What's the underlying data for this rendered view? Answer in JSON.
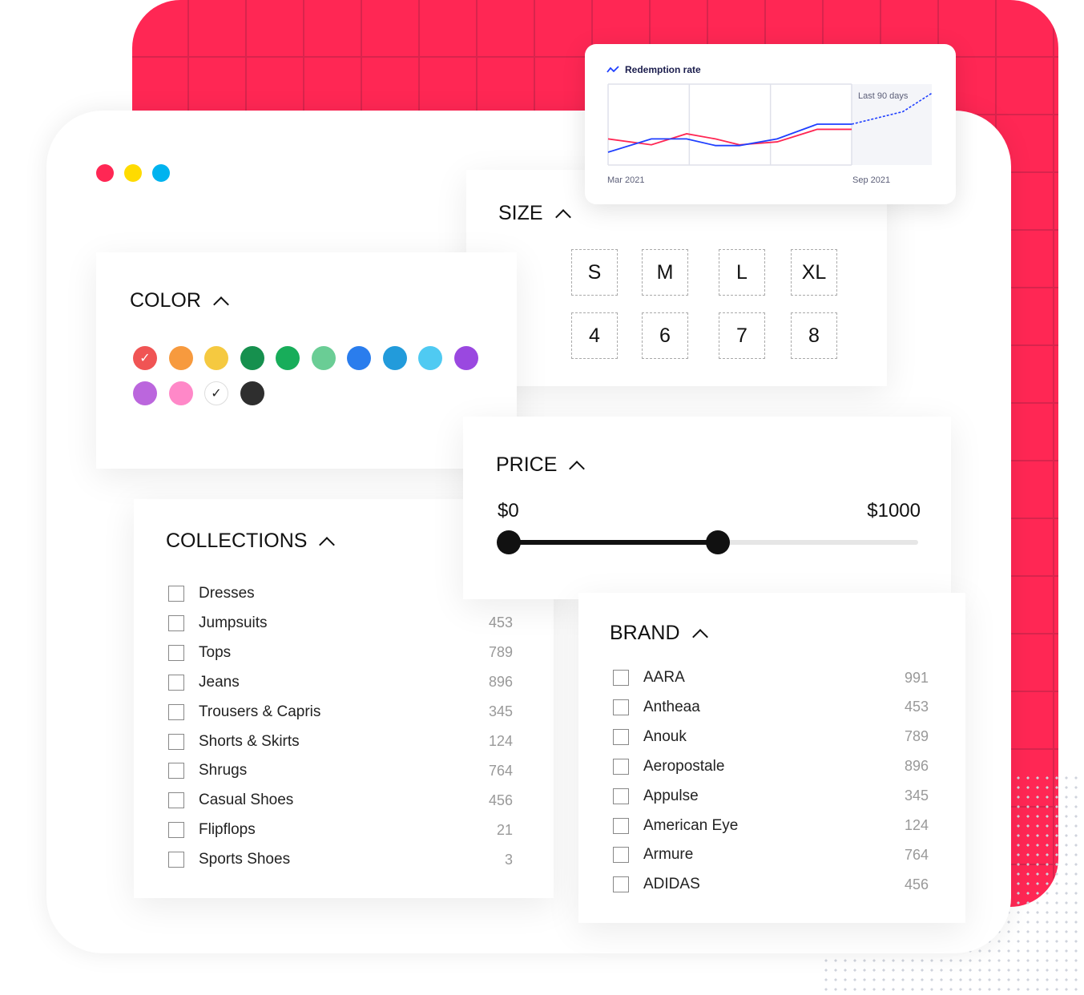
{
  "window_dots": [
    "#ff2754",
    "#ffdb00",
    "#00b3ef"
  ],
  "chart_card": {
    "title": "Redemption rate",
    "shaded_label": "Last 90 days",
    "x_start": "Mar 2021",
    "x_end": "Sep 2021"
  },
  "chart_data": {
    "type": "line",
    "title": "Redemption rate",
    "x_tick_labels": [
      "Mar 2021",
      "Sep 2021"
    ],
    "annotation": "Last 90 days",
    "grid": true,
    "series": [
      {
        "color": "#ff2754",
        "values": [
          30,
          22,
          37,
          30,
          22,
          26,
          43,
          43
        ]
      },
      {
        "color": "#1f3fff",
        "values": [
          12,
          30,
          30,
          21,
          21,
          30,
          50,
          50
        ],
        "projection": [
          50,
          67,
          92
        ]
      }
    ]
  },
  "color": {
    "title": "COLOR",
    "swatches": [
      {
        "hex": "#f05454",
        "selected": true
      },
      {
        "hex": "#f79a3e"
      },
      {
        "hex": "#f5c940"
      },
      {
        "hex": "#16904e"
      },
      {
        "hex": "#18ad5a"
      },
      {
        "hex": "#6acd95"
      },
      {
        "hex": "#2a7ded"
      },
      {
        "hex": "#229bdb"
      },
      {
        "hex": "#4fcaf2"
      },
      {
        "hex": "#9a48e0"
      },
      {
        "hex": "#bb66dd"
      },
      {
        "hex": "#ff88c8"
      },
      {
        "hex": "#ffffff",
        "selected": true
      },
      {
        "hex": "#2e2e2e"
      }
    ]
  },
  "size": {
    "title": "SIZE",
    "options": [
      "S",
      "M",
      "L",
      "XL",
      "4",
      "6",
      "7",
      "8"
    ]
  },
  "price": {
    "title": "PRICE",
    "min_label": "$0",
    "max_label": "$1000",
    "range_low_pct": 0,
    "range_high_pct": 51
  },
  "collections": {
    "title": "COLLECTIONS",
    "items": [
      {
        "label": "Dresses",
        "count": ""
      },
      {
        "label": "Jumpsuits",
        "count": "453"
      },
      {
        "label": "Tops",
        "count": "789"
      },
      {
        "label": "Jeans",
        "count": "896"
      },
      {
        "label": "Trousers & Capris",
        "count": "345"
      },
      {
        "label": "Shorts & Skirts",
        "count": "124"
      },
      {
        "label": "Shrugs",
        "count": "764"
      },
      {
        "label": "Casual Shoes",
        "count": "456"
      },
      {
        "label": "Flipflops",
        "count": "21"
      },
      {
        "label": "Sports Shoes",
        "count": "3"
      }
    ]
  },
  "brand": {
    "title": "BRAND",
    "items": [
      {
        "label": "AARA",
        "count": "991"
      },
      {
        "label": "Antheaa",
        "count": "453"
      },
      {
        "label": "Anouk",
        "count": "789"
      },
      {
        "label": "Aeropostale",
        "count": "896"
      },
      {
        "label": "Appulse",
        "count": "345"
      },
      {
        "label": "American Eye",
        "count": "124"
      },
      {
        "label": "Armure",
        "count": "764"
      },
      {
        "label": "ADIDAS",
        "count": "456"
      }
    ]
  }
}
